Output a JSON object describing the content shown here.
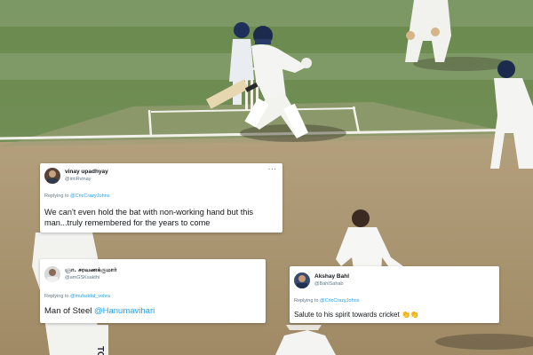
{
  "colors": {
    "outfield_green": "#6e8c52",
    "pitch_brown": "#a89472",
    "mention_blue": "#1da1f2",
    "muted_grey": "#657786"
  },
  "tweets": [
    {
      "display_name": "vinay upadhyay",
      "handle": "@imiRvinay",
      "reply_prefix": "Replying to ",
      "reply_to": "@CricCrazyJohns",
      "text": "We can't even hold the bat with non-working hand but this man...truly remembered for the years to come",
      "more": "···"
    },
    {
      "display_name": "ஞா. சரவணக்குமார்",
      "handle": "@amGSKsakthi",
      "reply_prefix": "Replying to ",
      "reply_to": "@mufaddal_vohra",
      "text_prefix": "Man of Steel ",
      "text_mention": "@Hanumavihari"
    },
    {
      "display_name": "Akshay Bahl",
      "handle": "@BahlSahab",
      "reply_prefix": "Replying to ",
      "reply_to": "@CricCrazyJohns",
      "text": "Salute to his spirit towards cricket",
      "emoji": "👏👏"
    }
  ],
  "shirt_text": "TON"
}
